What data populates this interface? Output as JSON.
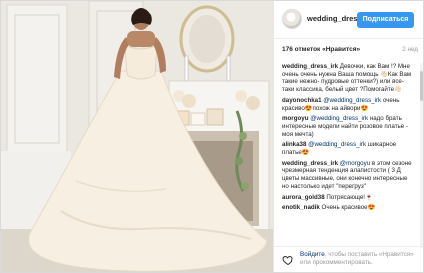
{
  "post": {
    "username": "wedding_dres...",
    "follow_label": "Подписаться",
    "likes": "176 отметок «Нравится»",
    "time": "2 нед"
  },
  "comments": [
    {
      "user": "wedding_dress_irk",
      "text": " Девочки, как Вам !? Мне очень очень нужна Ваша помощь 👋🏻Как Вам такие нежно- пудровые оттенки?) или все-таки классика, белый цвет ?Помогайте👋🏻"
    },
    {
      "user": "dayonochka1",
      "mention": "@wedding_dress_irk",
      "text": " очень красиво😍похож на айвори😍"
    },
    {
      "user": "morgoyu",
      "mention": "@wedding_dress_irk",
      "text": " надо брать интересные модели найти розовое платье - моя мечта)"
    },
    {
      "user": "alinka38",
      "mention": "@wedding_dress_irk",
      "text": " шикарное платье😍"
    },
    {
      "user": "wedding_dress_irk",
      "mention": "@morgoyu",
      "text": " в этом сезоне чрезмерная тенденция алапистости ( 3 Д цветы массивные, они конечно интересные но настолько идет \"перегруз\""
    },
    {
      "user": "aurora_gold38",
      "text": " Потрясающе!🍷"
    },
    {
      "user": "enotik_nadik",
      "text": " Очень красивое😍"
    }
  ],
  "footer": {
    "login_link": "Войдите",
    "login_text": ", чтобы поставить «Нравится» или прокомментировать."
  }
}
